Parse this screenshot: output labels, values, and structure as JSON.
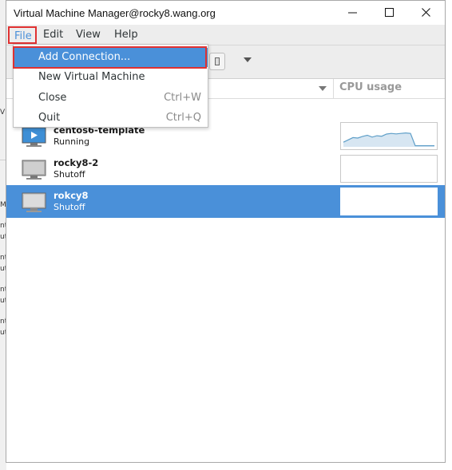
{
  "window": {
    "title": "Virtual Machine Manager@rocky8.wang.org"
  },
  "menubar": {
    "file": "File",
    "edit": "Edit",
    "view": "View",
    "help": "Help"
  },
  "file_menu": {
    "items": [
      {
        "label": "Add Connection...",
        "accel": ""
      },
      {
        "label": "New Virtual Machine",
        "accel": ""
      },
      {
        "label": "Close",
        "accel": "Ctrl+W"
      },
      {
        "label": "Quit",
        "accel": "Ctrl+Q"
      }
    ]
  },
  "columns": {
    "cpu": "CPU usage"
  },
  "vms": [
    {
      "name": "centos6-template",
      "status": "Running"
    },
    {
      "name": "rocky8-2",
      "status": "Shutoff"
    },
    {
      "name": "rokcy8",
      "status": "Shutoff"
    }
  ],
  "cpu_graph": {
    "running_values": [
      20,
      30,
      40,
      38,
      45,
      50,
      42,
      48,
      46,
      55,
      58,
      56,
      58,
      60,
      58,
      5,
      5,
      5,
      5,
      5
    ]
  },
  "colors": {
    "accent": "#4a90d9",
    "annotation": "#e03131"
  },
  "background_fragments": [
    "V",
    "M",
    "nt",
    "ut",
    "nt",
    "ut",
    "nt",
    "ut",
    "nt",
    "ut"
  ]
}
